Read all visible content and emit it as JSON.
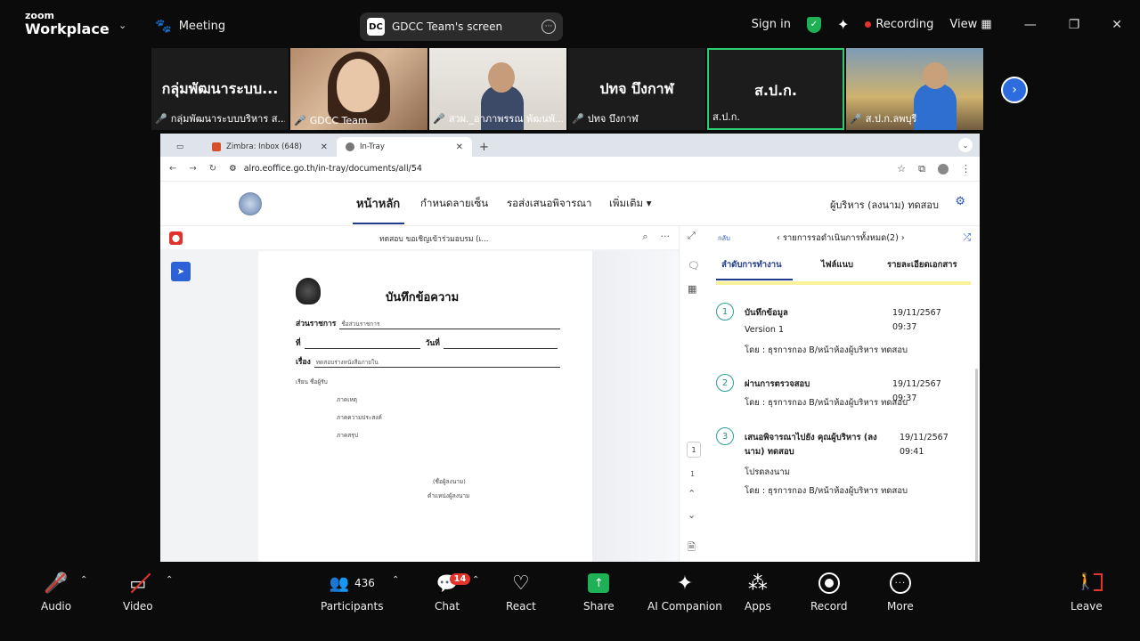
{
  "zoom": {
    "brand_top": "zoom",
    "brand_bottom": "Workplace",
    "meeting_label": "Meeting",
    "screen_pill_label": "GDCC Team's screen",
    "sign_in": "Sign in",
    "recording": "Recording",
    "view": "View"
  },
  "participants": [
    {
      "big": "กลุ่มพัฒนาระบบ...",
      "caption": "กลุ่มพัฒนาระบบบริหาร ส...",
      "muted": true
    },
    {
      "big": "",
      "caption": "GDCC Team",
      "muted": true
    },
    {
      "big": "",
      "caption": "สวผ._อาภาพรรณ พัฒนพั...",
      "muted": true
    },
    {
      "big": "ปทจ บึงกาฬ",
      "caption": "ปทจ บึงกาฬ",
      "muted": true
    },
    {
      "big": "ส.ป.ก.",
      "caption": "ส.ป.ก.",
      "muted": false
    },
    {
      "big": "",
      "caption": "ส.ป.ก.ลพบุรี",
      "muted": true
    }
  ],
  "browser": {
    "tab_zimbra": "Zimbra: Inbox (648)",
    "tab_intray": "In-Tray",
    "url": "alro.eoffice.go.th/in-tray/documents/all/54"
  },
  "app_nav": {
    "home": "หน้าหลัก",
    "signature": "กำหนดลายเซ็น",
    "pending": "รอส่งเสนอพิจารณา",
    "more": "เพิ่มเติม ▾",
    "user": "ผู้บริหาร (ลงนาม) ทดสอบ"
  },
  "viewer": {
    "doc_title": "ทดสอบ ขอเชิญเข้าร่วมอบรม (เ...",
    "page_current": "1",
    "page_total": "1"
  },
  "memo": {
    "title": "บันทึกข้อความ",
    "dept_label": "ส่วนราชการ",
    "dept_value": "ชื่อส่วนราชการ",
    "no_label": "ที่",
    "date_label": "วันที่",
    "subject_label": "เรื่อง",
    "subject_value": "ทดสอบร่างหนังสือภายใน",
    "to_line": "เรียน   ชื่อผู้รับ",
    "para1": "ภาคเหตุ",
    "para2": "ภาคความประสงค์",
    "para3": "ภาคสรุป",
    "signer": "(ชื่อผู้ลงนาม)",
    "signer_pos": "ตำแหน่งผู้ลงนาม"
  },
  "panel": {
    "back": "กลับ",
    "pending_title": "‹   รายการรอดำเนินการทั้งหมด(2)   ›",
    "tab_workflow": "ลำดับการทำงาน",
    "tab_attach": "ไฟล์แนบ",
    "tab_details": "รายละเอียดเอกสาร",
    "steps": [
      {
        "num": "1",
        "title": "บันทึกข้อมูล",
        "date": "19/11/2567 09:37",
        "line1": "Version 1",
        "line2": "โดย : ธุรการกอง B/หน้าห้องผู้บริหาร ทดสอบ"
      },
      {
        "num": "2",
        "title": "ผ่านการตรวจสอบ",
        "date": "19/11/2567 09:37",
        "line1": "",
        "line2": "โดย : ธุรการกอง B/หน้าห้องผู้บริหาร ทดสอบ"
      },
      {
        "num": "3",
        "title": "เสนอพิจารณาไปยัง คุณผู้บริหาร (ลงนาม) ทดสอบ",
        "date": "19/11/2567 09:41",
        "line1": "โปรดลงนาม",
        "line2": "โดย : ธุรการกอง B/หน้าห้องผู้บริหาร ทดสอบ"
      }
    ]
  },
  "toolbar": {
    "audio": "Audio",
    "video": "Video",
    "participants": "Participants",
    "participant_count": "436",
    "chat": "Chat",
    "chat_badge": "14",
    "react": "React",
    "share": "Share",
    "ai": "AI Companion",
    "apps": "Apps",
    "record": "Record",
    "more": "More",
    "leave": "Leave"
  }
}
